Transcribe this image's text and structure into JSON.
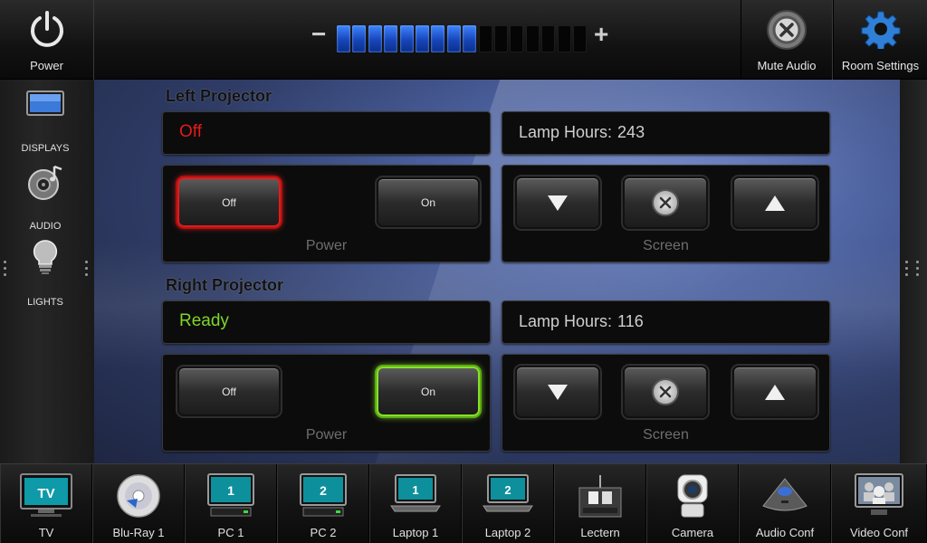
{
  "top": {
    "power_label": "Power",
    "mute_label": "Mute Audio",
    "room_settings_label": "Room Settings",
    "volume": {
      "minus": "−",
      "plus": "+",
      "level": 9,
      "segments": 16
    }
  },
  "sidebar": {
    "items": [
      {
        "label": "DISPLAYS",
        "icon": "monitor-icon"
      },
      {
        "label": "AUDIO",
        "icon": "music-disc-icon"
      },
      {
        "label": "LIGHTS",
        "icon": "light-bulb-icon"
      }
    ]
  },
  "left_projector": {
    "title": "Left Projector",
    "status": "Off",
    "status_color": "#e21b1b",
    "lamp_label": "Lamp Hours:",
    "lamp_hours": "243",
    "power_off_label": "Off",
    "power_on_label": "On",
    "power_caption": "Power",
    "screen_caption": "Screen",
    "active": "off"
  },
  "right_projector": {
    "title": "Right Projector",
    "status": "Ready",
    "status_color": "#7fd62a",
    "lamp_label": "Lamp Hours:",
    "lamp_hours": "116",
    "power_off_label": "Off",
    "power_on_label": "On",
    "power_caption": "Power",
    "screen_caption": "Screen",
    "active": "on"
  },
  "sources": [
    {
      "label": "TV",
      "icon": "tv-icon"
    },
    {
      "label": "Blu-Ray 1",
      "icon": "bluray-disc-icon"
    },
    {
      "label": "PC 1",
      "icon": "pc-monitor-icon",
      "badge": "1"
    },
    {
      "label": "PC 2",
      "icon": "pc-monitor-icon",
      "badge": "2"
    },
    {
      "label": "Laptop 1",
      "icon": "laptop-icon",
      "badge": "1"
    },
    {
      "label": "Laptop 2",
      "icon": "laptop-icon",
      "badge": "2"
    },
    {
      "label": "Lectern",
      "icon": "lectern-icon"
    },
    {
      "label": "Camera",
      "icon": "camera-icon"
    },
    {
      "label": "Audio Conf",
      "icon": "conference-phone-icon"
    },
    {
      "label": "Video Conf",
      "icon": "video-conference-icon"
    }
  ],
  "colors": {
    "accent_blue": "#2a5fe0",
    "alert_red": "#e21b1b",
    "ready_green": "#7fd62a"
  }
}
